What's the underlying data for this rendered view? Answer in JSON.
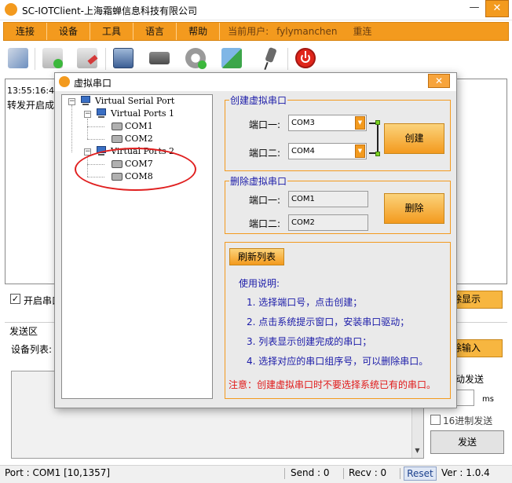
{
  "window": {
    "title": "SC-IOTClient-上海霜蝉信息科技有限公司",
    "min_glyph": "—",
    "max_glyph": "▭",
    "close_glyph": "✕"
  },
  "menu": {
    "items": [
      "连接",
      "设备",
      "工具",
      "语言",
      "帮助"
    ],
    "current_user_label": "当前用户:",
    "current_user": "fylymanchen",
    "reconnect": "重连"
  },
  "toolbar": {
    "icons": [
      "network-icon",
      "router-add-icon",
      "router-edit-icon",
      "monitor-settings-icon",
      "device-icon",
      "gear-add-icon",
      "transfer-icon",
      "pin-icon",
      "power-icon"
    ]
  },
  "main": {
    "recv_time": "13:55:16:4",
    "recv_text": "转发开启成",
    "auto_open_label": "开启串口",
    "clear_display": "除显示",
    "send_area": "发送区",
    "device_list": "设备列表:",
    "clear_input": "除输入",
    "auto_send": "动发送",
    "ms_unit": "ms",
    "hex_send": "16进制发送",
    "send": "发送"
  },
  "status": {
    "port": "Port : COM1 [10,1357]",
    "send": "Send :   0",
    "recv": "Recv :   0",
    "reset": "Reset",
    "ver": "Ver :   1.0.4"
  },
  "dialog": {
    "title": "虚拟串口",
    "close_glyph": "✕",
    "tree": {
      "root": "Virtual Serial Port",
      "groups": [
        {
          "label": "Virtual Ports 1",
          "ports": [
            "COM1",
            "COM2"
          ]
        },
        {
          "label": "Virtual Ports 2",
          "ports": [
            "COM7",
            "COM8"
          ]
        }
      ]
    },
    "create_group": {
      "title": "创建虚拟串口",
      "port1_label": "端口一:",
      "port1_value": "COM3",
      "port2_label": "端口二:",
      "port2_value": "COM4",
      "create_btn": "创建"
    },
    "delete_group": {
      "title": "删除虚拟串口",
      "port1_label": "端口一:",
      "port1_value": "COM1",
      "port2_label": "端口二:",
      "port2_value": "COM2",
      "delete_btn": "删除"
    },
    "help_group": {
      "refresh_btn": "刷新列表",
      "usage_title": "使用说明:",
      "steps": [
        "1. 选择端口号，点击创建；",
        "2. 点击系统提示窗口，安装串口驱动；",
        "3. 列表显示创建完成的串口；",
        "4. 选择对应的串口组序号，可以删除串口。"
      ],
      "warning": "注意：创建虚拟串口时不要选择系统已有的串口。"
    }
  },
  "colors": {
    "accent": "#f39a1e",
    "group_title": "#1a1aa8",
    "warning": "#e01818",
    "annotation": "#e02020"
  }
}
